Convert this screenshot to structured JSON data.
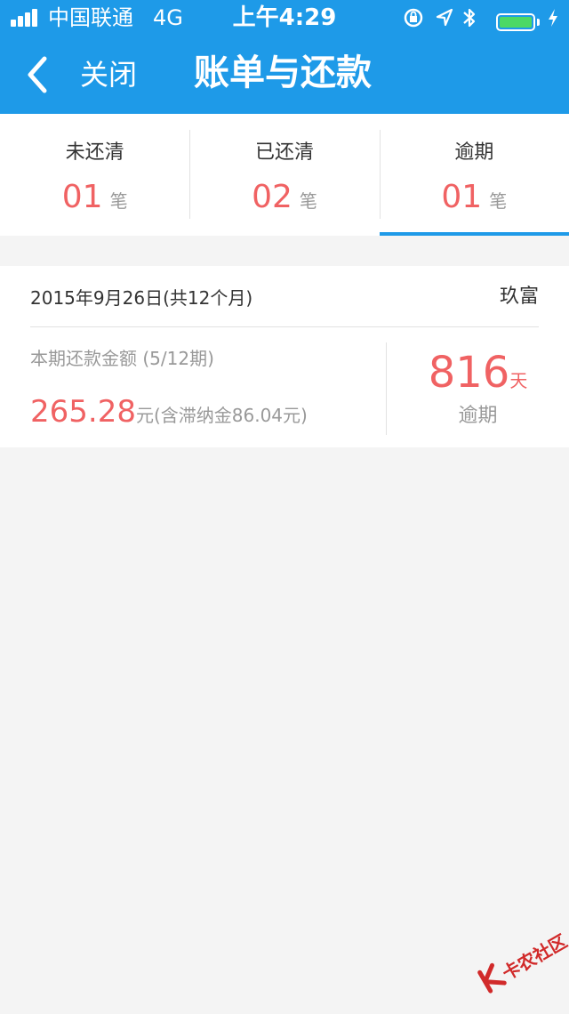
{
  "status_bar": {
    "carrier": "中国联通",
    "network": "4G",
    "time": "上午4:29",
    "battery_color": "#4cd964"
  },
  "nav": {
    "back_icon": "chevron-left-icon",
    "close_label": "关闭",
    "title": "账单与还款",
    "bar_color": "#1e9ae8"
  },
  "tabs": [
    {
      "label": "未还清",
      "count": "01",
      "unit": "笔",
      "active": false
    },
    {
      "label": "已还清",
      "count": "02",
      "unit": "笔",
      "active": false
    },
    {
      "label": "逾期",
      "count": "01",
      "unit": "笔",
      "active": true
    }
  ],
  "bill": {
    "date": "2015年9月26日(共12个月)",
    "lender": "玖富",
    "amount_label": "本期还款金额 (5/12期)",
    "amount": "265.28",
    "amount_note": "元(含滞纳金86.04元)",
    "overdue_days": "816",
    "overdue_unit": "天",
    "overdue_label": "逾期",
    "accent_color": "#f06263"
  },
  "watermark": {
    "text": "卡农社区"
  }
}
